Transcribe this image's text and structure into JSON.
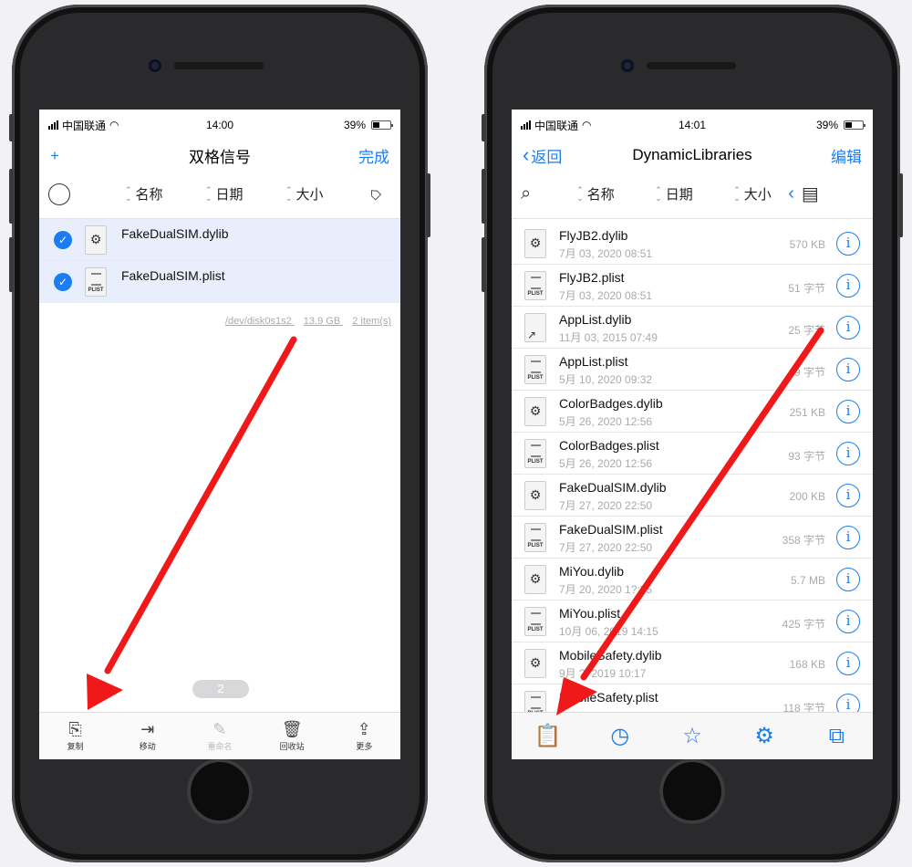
{
  "left": {
    "status": {
      "carrier": "中国联通",
      "time": "14:00",
      "battery": "39%"
    },
    "nav": {
      "left_icon": "+",
      "title": "双格信号",
      "right": "完成"
    },
    "sort": {
      "name": "名称",
      "date": "日期",
      "size": "大小"
    },
    "files": [
      {
        "name": "FakeDualSIM.dylib",
        "type": "dylib"
      },
      {
        "name": "FakeDualSIM.plist",
        "type": "plist"
      }
    ],
    "footer": {
      "disk": "/dev/disk0s1s2",
      "capacity": "13.9 GB",
      "items": "2 item(s)"
    },
    "page": "2",
    "toolbar": [
      {
        "label": "复制",
        "icon": "copy-icon",
        "glyph": "⎘"
      },
      {
        "label": "移动",
        "icon": "move-icon",
        "glyph": "⇥"
      },
      {
        "label": "重命名",
        "icon": "rename-icon",
        "glyph": "✎"
      },
      {
        "label": "回收站",
        "icon": "trash-icon",
        "glyph": "🗑"
      },
      {
        "label": "更多",
        "icon": "share-icon",
        "glyph": "⇪"
      }
    ]
  },
  "right": {
    "status": {
      "carrier": "中国联通",
      "time": "14:01",
      "battery": "39%"
    },
    "nav": {
      "back": "返回",
      "title": "DynamicLibraries",
      "right": "编辑"
    },
    "sort": {
      "name": "名称",
      "date": "日期",
      "size": "大小"
    },
    "files": [
      {
        "name": "FlyJB2.dylib",
        "date": "7月 03, 2020 08:51",
        "size": "570 KB",
        "type": "dylib"
      },
      {
        "name": "FlyJB2.plist",
        "date": "7月 03, 2020 08:51",
        "size": "51 字节",
        "type": "plist"
      },
      {
        "name": "AppList.dylib",
        "date": "11月 03, 2015 07:49",
        "size": "25 字节",
        "type": "link"
      },
      {
        "name": "AppList.plist",
        "date": "5月 10, 2020 09:32",
        "size": "9 字节",
        "type": "plist"
      },
      {
        "name": "ColorBadges.dylib",
        "date": "5月 26, 2020 12:56",
        "size": "251 KB",
        "type": "dylib"
      },
      {
        "name": "ColorBadges.plist",
        "date": "5月 26, 2020 12:56",
        "size": "93 字节",
        "type": "plist"
      },
      {
        "name": "FakeDualSIM.dylib",
        "date": "7月 27, 2020 22:50",
        "size": "200 KB",
        "type": "dylib"
      },
      {
        "name": "FakeDualSIM.plist",
        "date": "7月 27, 2020 22:50",
        "size": "358 字节",
        "type": "plist"
      },
      {
        "name": "MiYou.dylib",
        "date": "7月 20, 2020 1?:?5",
        "size": "5.7 MB",
        "type": "dylib"
      },
      {
        "name": "MiYou.plist",
        "date": "10月 06, 2019 14:15",
        "size": "425 字节",
        "type": "plist"
      },
      {
        "name": "MobileSafety.dylib",
        "date": "9月 ?, 2019 10:17",
        "size": "168 KB",
        "type": "dylib"
      },
      {
        "name": "MobileSafety.plist",
        "date": "",
        "size": "118 字节",
        "type": "plist"
      }
    ],
    "tabs": [
      "clipboard-icon",
      "clock-icon",
      "star-icon",
      "gear-icon",
      "windows-icon"
    ]
  },
  "colors": {
    "accent": "#1a7ef2",
    "arrow": "#f01818",
    "selected_row": "#e8eefb"
  }
}
